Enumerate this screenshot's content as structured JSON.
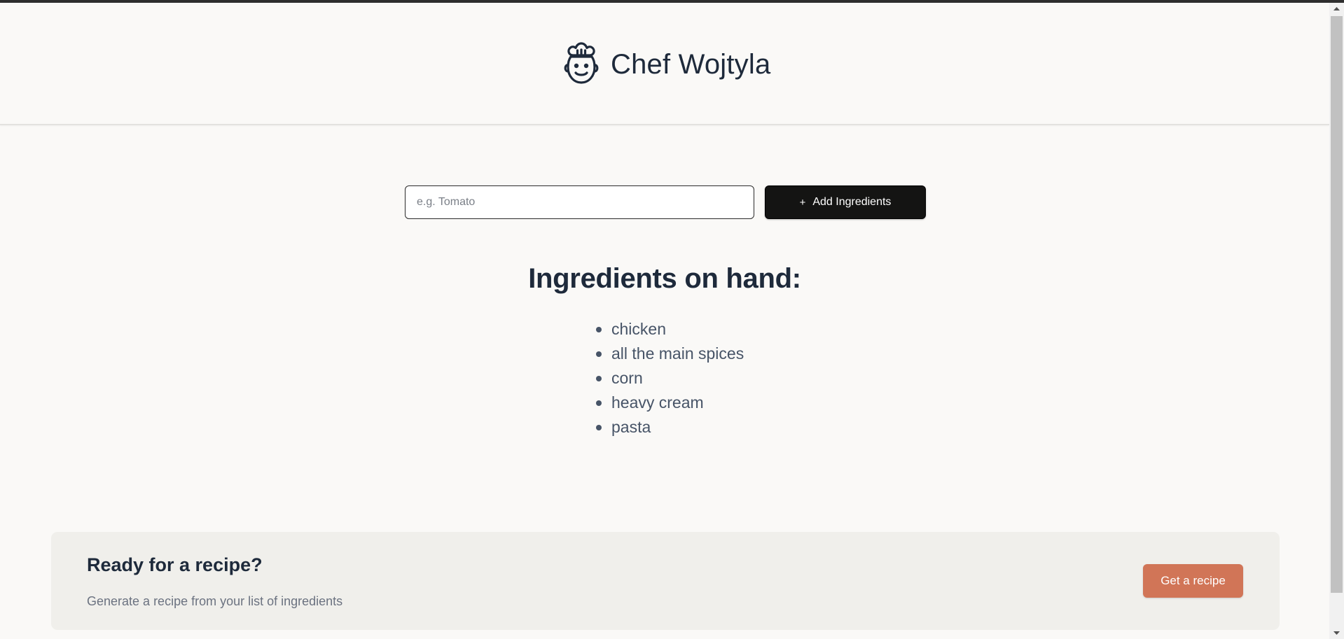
{
  "header": {
    "title": "Chef Wojtyla",
    "logo_icon": "chef-face-icon"
  },
  "form": {
    "input_placeholder": "e.g. Tomato",
    "input_value": "",
    "add_button_icon": "+",
    "add_button_label": "Add Ingredients"
  },
  "ingredients": {
    "title": "Ingredients on hand:",
    "items": [
      "chicken",
      "all the main spices",
      "corn",
      "heavy cream",
      "pasta"
    ]
  },
  "recipe_panel": {
    "title": "Ready for a recipe?",
    "subtitle": "Generate a recipe from your list of ingredients",
    "button_label": "Get a recipe"
  },
  "colors": {
    "background": "#FAF9F7",
    "text_primary": "#1E2A3B",
    "text_secondary": "#475467",
    "button_dark": "#141413",
    "accent": "#D17557",
    "panel": "#F0EFEB"
  }
}
